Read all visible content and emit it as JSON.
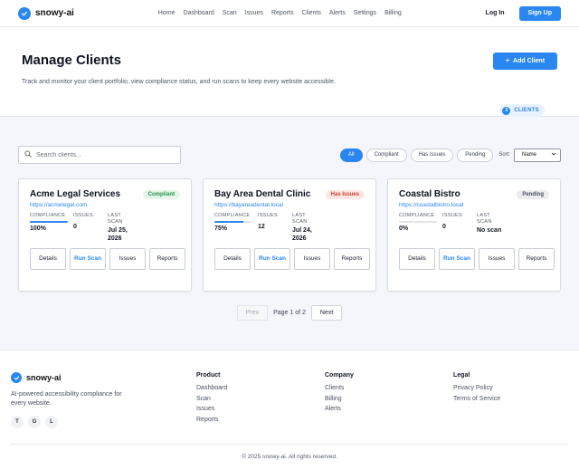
{
  "nav": {
    "brand": "snowy-ai",
    "links": [
      "Home",
      "Dashboard",
      "Scan",
      "Issues",
      "Reports",
      "Clients",
      "Alerts",
      "Settings",
      "Billing"
    ],
    "login": "Log In",
    "signup": "Sign Up"
  },
  "hero": {
    "title": "Manage Clients",
    "subtitle": "Track and monitor your client portfolio, view compliance status, and run scans to keep every website accessible.",
    "add_button": "Add Client",
    "add_icon": "+",
    "count": "3",
    "count_label": "CLIENTS"
  },
  "toolbar": {
    "search_placeholder": "Search clients...",
    "filters": [
      "All",
      "Compliant",
      "Has Issues",
      "Pending"
    ],
    "active_filter": "All",
    "sort_label": "Sort:",
    "sort_value": "Name"
  },
  "stat_labels": {
    "compliance": "COMPLIANCE",
    "issues": "ISSUES",
    "last_scan": "LAST SCAN"
  },
  "clients": [
    {
      "name": "Acme Legal Services",
      "url": "https://acmelegal.com",
      "status": "Compliant",
      "compliance": "100%",
      "compliance_fraction": 1.0,
      "issues": "0",
      "last_scan": "Jul 25, 2026",
      "actions": [
        "Details",
        "Run Scan",
        "Issues",
        "Reports"
      ]
    },
    {
      "name": "Bay Area Dental Clinic",
      "url": "https://bayareadental.local",
      "status": "Has Issues",
      "compliance": "75%",
      "compliance_fraction": 0.75,
      "issues": "12",
      "last_scan": "Jul 24, 2026",
      "actions": [
        "Details",
        "Run Scan",
        "Issues",
        "Reports"
      ]
    },
    {
      "name": "Coastal Bistro",
      "url": "https://coastalbistro.local",
      "status": "Pending",
      "compliance": "0%",
      "compliance_fraction": 0.0,
      "issues": "0",
      "last_scan": "No scan",
      "actions": [
        "Details",
        "Run Scan",
        "Issues",
        "Reports"
      ]
    }
  ],
  "pagination": {
    "prev": "Prev",
    "info": "Page 1 of 2",
    "next": "Next"
  },
  "footer": {
    "brand": "snowy-ai",
    "description": "AI-powered accessibility compliance for every website.",
    "socials": [
      "T",
      "G",
      "L"
    ],
    "columns": [
      {
        "title": "Product",
        "items": [
          "Dashboard",
          "Scan",
          "Issues",
          "Reports"
        ]
      },
      {
        "title": "Company",
        "items": [
          "Clients",
          "Billing",
          "Alerts"
        ]
      },
      {
        "title": "Legal",
        "items": [
          "Privacy Policy",
          "Terms of Service"
        ]
      }
    ],
    "copyright": "© 2025 snowy-ai. All rights reserved."
  },
  "colors": {
    "accent": "#2a86f1",
    "compliant": "#24944b",
    "issues": "#c8412f",
    "pending": "#4b5160"
  }
}
